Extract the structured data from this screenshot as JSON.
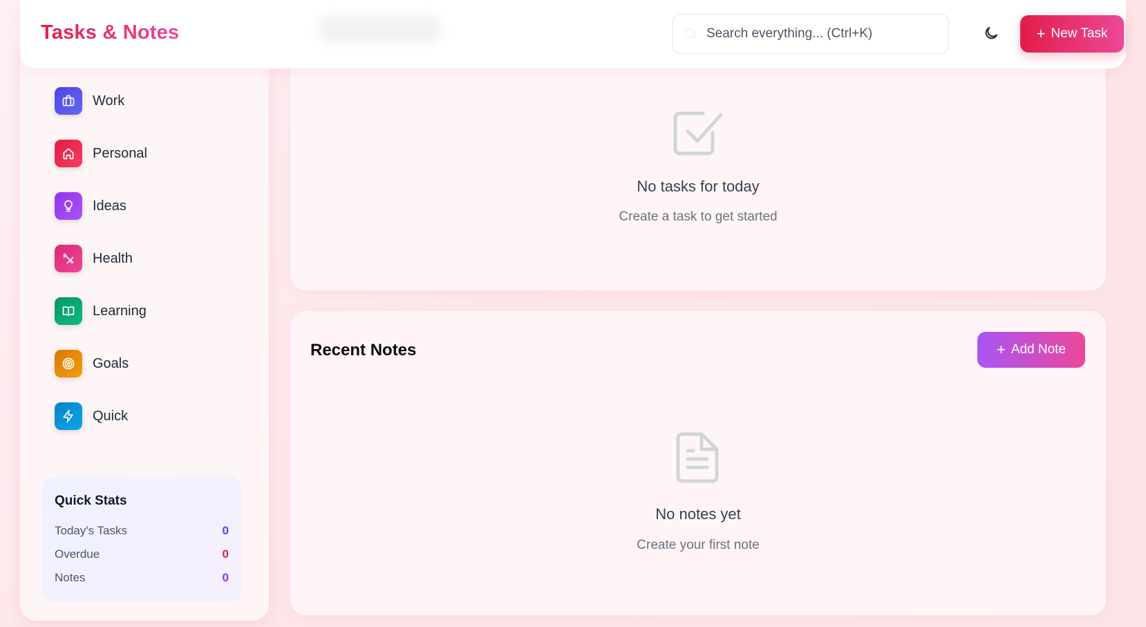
{
  "header": {
    "brand": "Tasks & Notes",
    "search_placeholder": "Search everything... (Ctrl+K)",
    "theme_icon": "moon-icon",
    "new_task_label": "New Task"
  },
  "sidebar": {
    "categories": [
      {
        "label": "Work",
        "icon": "briefcase-icon",
        "color_from": "#4f46e5",
        "color_to": "#6366f1"
      },
      {
        "label": "Personal",
        "icon": "home-icon",
        "color_from": "#e11d48",
        "color_to": "#f43f5e"
      },
      {
        "label": "Ideas",
        "icon": "lightbulb-icon",
        "color_from": "#9333ea",
        "color_to": "#a855f7"
      },
      {
        "label": "Health",
        "icon": "dumbbell-icon",
        "color_from": "#db2777",
        "color_to": "#ec4899"
      },
      {
        "label": "Learning",
        "icon": "book-icon",
        "color_from": "#059669",
        "color_to": "#10b981"
      },
      {
        "label": "Goals",
        "icon": "target-icon",
        "color_from": "#d97706",
        "color_to": "#f59e0b"
      },
      {
        "label": "Quick",
        "icon": "lightning-icon",
        "color_from": "#0284c7",
        "color_to": "#0ea5e9"
      }
    ],
    "quick_stats": {
      "title": "Quick Stats",
      "rows": [
        {
          "label": "Today's Tasks",
          "value": "0",
          "color": "#4f46e5"
        },
        {
          "label": "Overdue",
          "value": "0",
          "color": "#e11d48"
        },
        {
          "label": "Notes",
          "value": "0",
          "color": "#9333ea"
        }
      ]
    }
  },
  "tasks": {
    "empty_title": "No tasks for today",
    "empty_subtitle": "Create a task to get started"
  },
  "notes": {
    "title": "Recent Notes",
    "add_label": "Add Note",
    "empty_title": "No notes yet",
    "empty_subtitle": "Create your first note"
  },
  "colors": {
    "accent_rose": "#e11d48",
    "accent_pink": "#ec4899",
    "accent_purple": "#a855f7"
  }
}
